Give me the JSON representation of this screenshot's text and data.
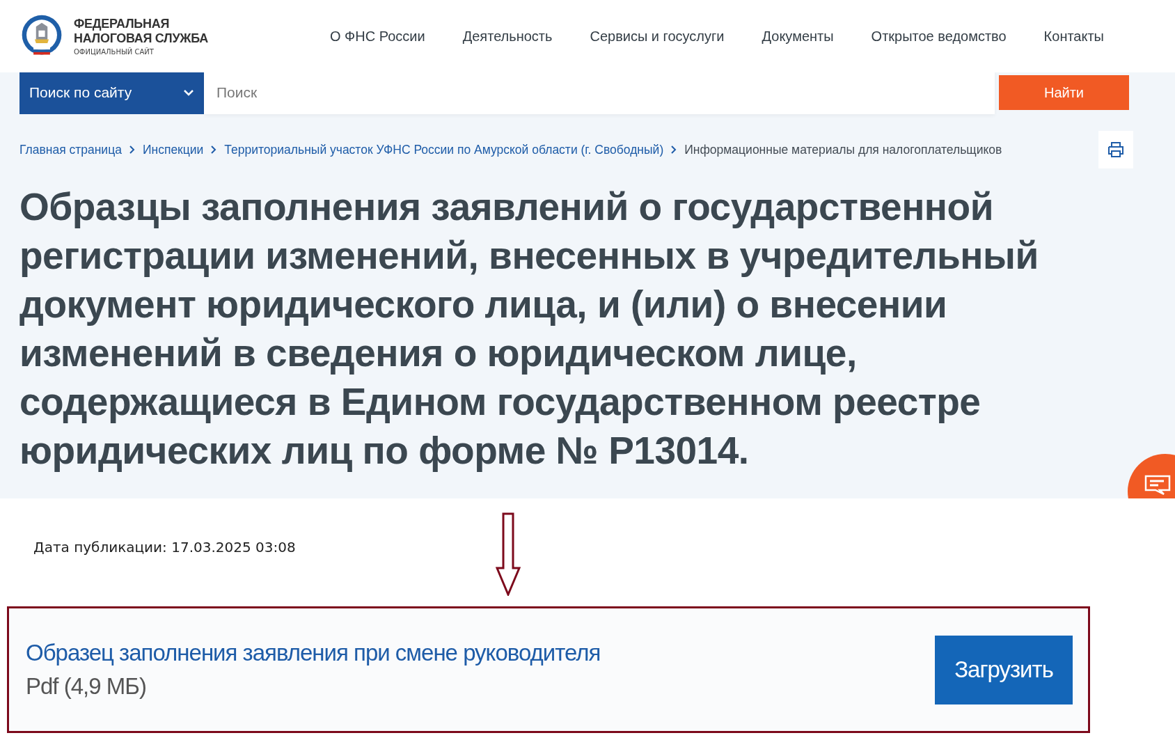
{
  "logo": {
    "title_line_1": "ФЕДЕРАЛЬНАЯ",
    "title_line_2": "НАЛОГОВАЯ СЛУЖБА",
    "subtitle": "ОФИЦИАЛЬНЫЙ САЙТ"
  },
  "nav": [
    "О ФНС России",
    "Деятельность",
    "Сервисы и госуслуги",
    "Документы",
    "Открытое ведомство",
    "Контакты"
  ],
  "search": {
    "scope": "Поиск по сайту",
    "placeholder": "Поиск",
    "button": "Найти"
  },
  "breadcrumbs": [
    {
      "label": "Главная страница",
      "link": true
    },
    {
      "label": "Инспекции",
      "link": true
    },
    {
      "label": "Территориальный участок УФНС России по Амурской области (г. Свободный)",
      "link": true
    },
    {
      "label": "Информационные материалы для налогоплательщиков",
      "link": false
    }
  ],
  "title": "Образцы заполнения заявлений о государственной регистрации изменений, внесенных в учредительный документ юридического лица, и (или) о внесении изменений в сведения о юридическом лице, содержащиеся в Едином государственном реестре юридических лиц по форме № Р13014.",
  "published": "Дата публикации: 17.03.2025 03:08",
  "file": {
    "name": "Образец заполнения заявления при смене руководителя",
    "meta": "Pdf (4,9 МБ)",
    "button": "Загрузить",
    "highlighted": true
  }
}
